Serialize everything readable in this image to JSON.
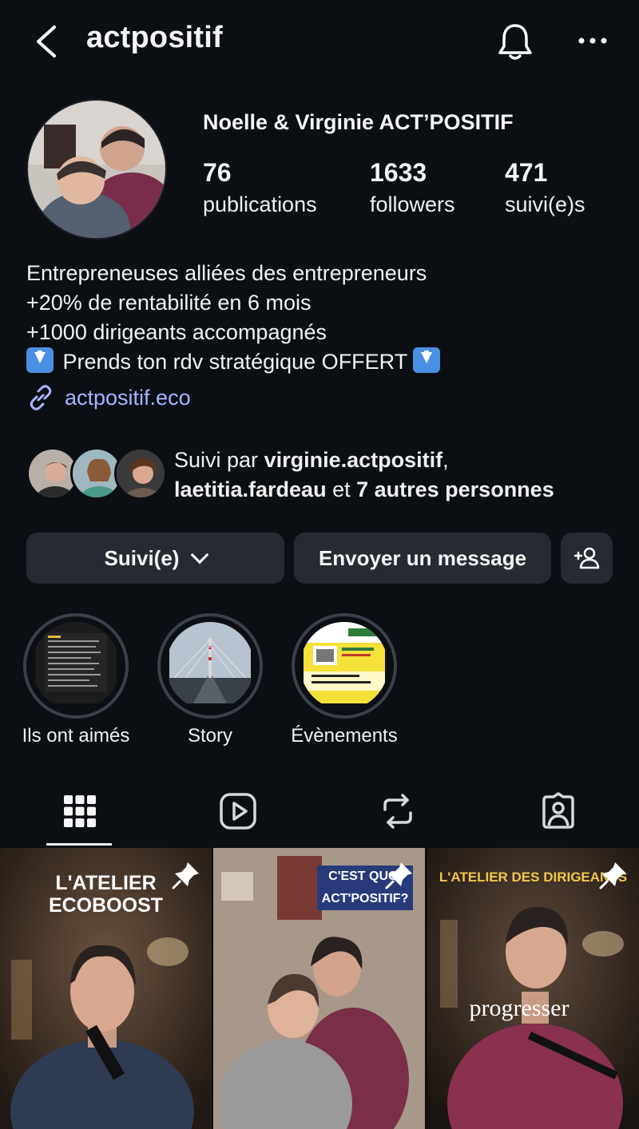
{
  "header": {
    "username": "actpositif",
    "back_icon": "chevron-left-icon",
    "bell_icon": "bell-icon",
    "more_icon": "more-horizontal-icon"
  },
  "profile": {
    "full_name": "Noelle & Virginie ACT’POSITIF",
    "stats": [
      {
        "value": "76",
        "label": "publications"
      },
      {
        "value": "1633",
        "label": "followers"
      },
      {
        "value": "471",
        "label": "suivi(e)s"
      }
    ],
    "bio": [
      "Entrepreneuses alliées des entrepreneurs",
      "+20% de rentabilité en 6 mois",
      "+1000 dirigeants accompagnés"
    ],
    "bio_cta": " Prends ton rdv stratégique OFFERT ",
    "link": "actpositif.eco"
  },
  "followed_by": {
    "prefix": "Suivi par ",
    "user1": "virginie.actpositif",
    "sep": ",",
    "user2": "laetitia.fardeau",
    "mid": " et ",
    "others": "7 autres personnes"
  },
  "actions": {
    "following_label": "Suivi(e)",
    "message_label": "Envoyer un message",
    "add_user_icon": "add-user-icon"
  },
  "highlights": [
    {
      "label": "Ils ont aimés"
    },
    {
      "label": "Story"
    },
    {
      "label": "Évènements"
    }
  ],
  "tabs": [
    "grid-icon",
    "reels-icon",
    "reposts-icon",
    "tagged-icon"
  ],
  "posts": [
    {
      "title_line1": "L'ATELIER",
      "title_line2": "ECOBOOST",
      "pinned": true
    },
    {
      "title_line1": "C'EST QUOI",
      "title_line2": "ACT'POSITIF?",
      "pinned": true
    },
    {
      "title_line1": "L'ATELIER DES DIRIGEANTS",
      "caption": "progresser",
      "pinned": true
    }
  ],
  "colors": {
    "background": "#0b0f14",
    "button": "#262b33",
    "link": "#a7b4ff"
  }
}
